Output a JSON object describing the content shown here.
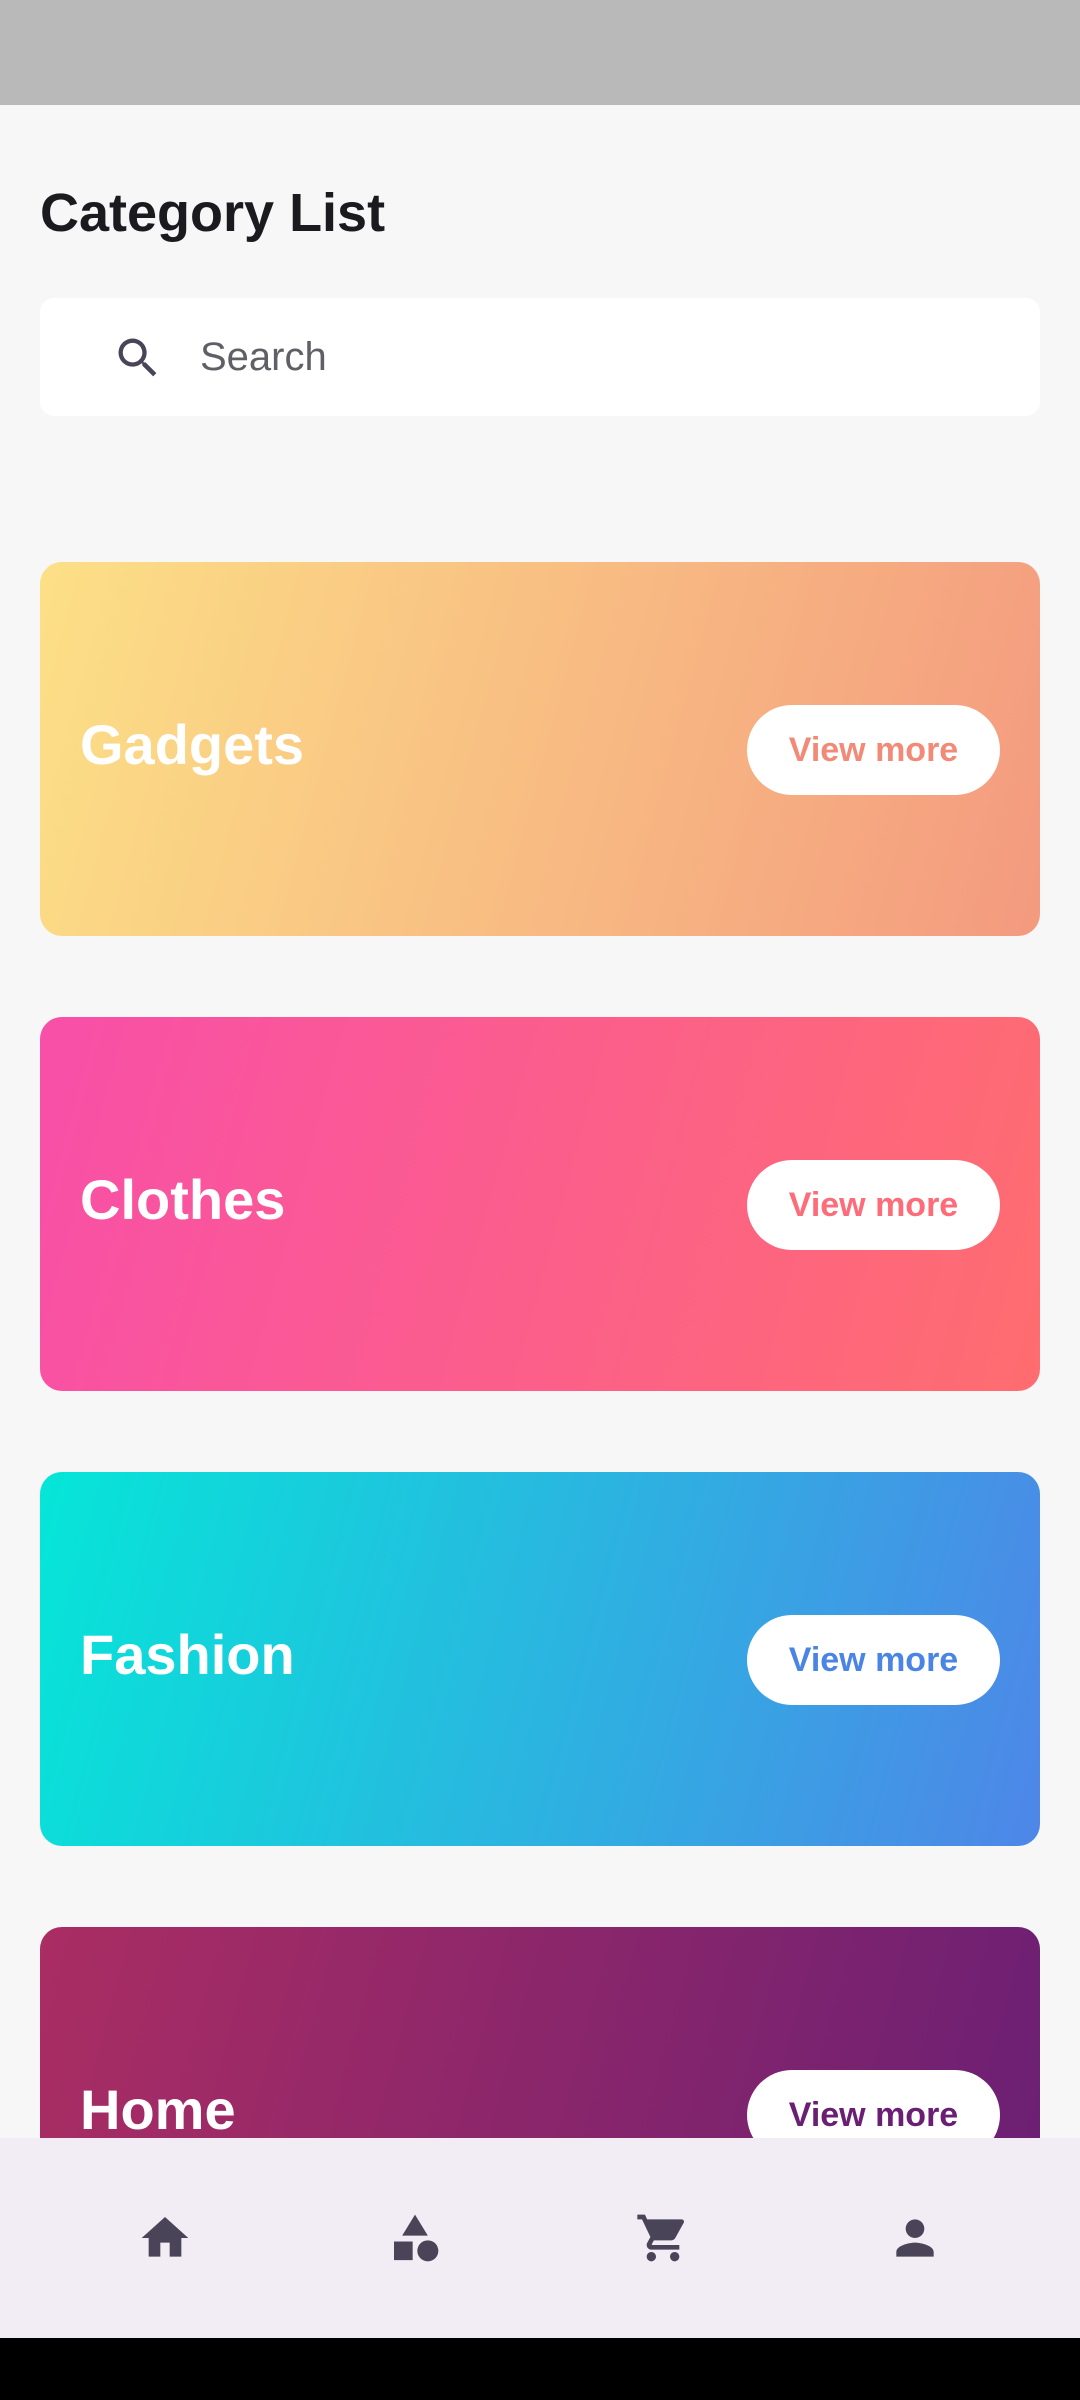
{
  "header": {
    "title": "Category List"
  },
  "search": {
    "placeholder": "Search",
    "value": ""
  },
  "categories": [
    {
      "name": "Gadgets",
      "button_label": "View more",
      "gradient": [
        "#fce086",
        "#f49a7f"
      ],
      "button_text_color": "#f28a78"
    },
    {
      "name": "Clothes",
      "button_label": "View more",
      "gradient": [
        "#f84fa8",
        "#ff6d6f"
      ],
      "button_text_color": "#fd6c78"
    },
    {
      "name": "Fashion",
      "button_label": "View more",
      "gradient": [
        "#05e6d8",
        "#4e86e8"
      ],
      "button_text_color": "#4a84e4"
    },
    {
      "name": "Home",
      "button_label": "View more",
      "gradient": [
        "#aa2d63",
        "#6a1f74"
      ],
      "button_text_color": "#6a1f74"
    }
  ],
  "bottom_nav": {
    "items": [
      {
        "icon": "home-icon"
      },
      {
        "icon": "categories-icon"
      },
      {
        "icon": "cart-icon"
      },
      {
        "icon": "profile-icon"
      }
    ],
    "icon_color": "#4a4458"
  }
}
